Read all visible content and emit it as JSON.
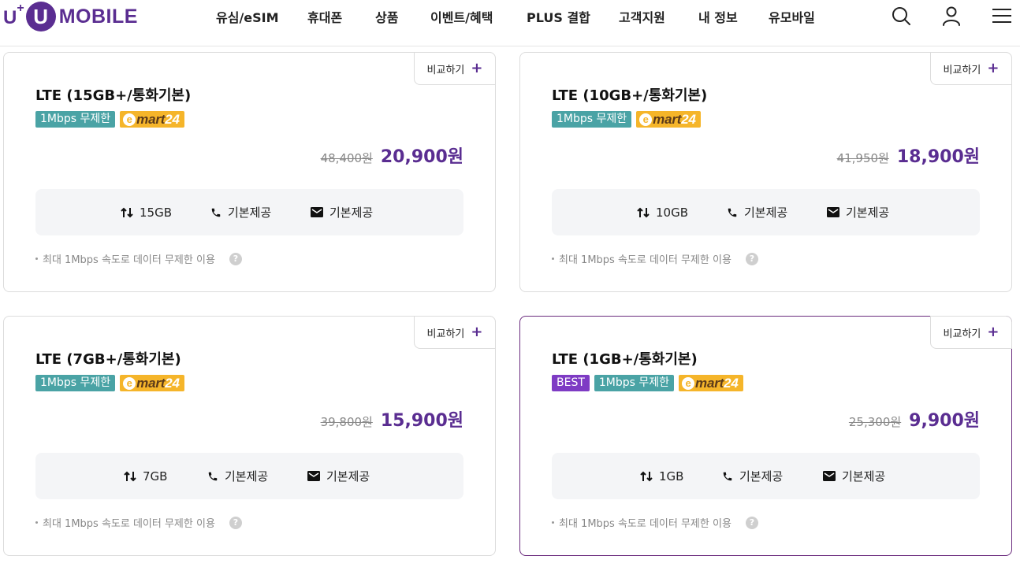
{
  "brand": {
    "uplus": "U",
    "uplus_sup": "+",
    "circle": "U",
    "word": "MOBILE",
    "color": "#5a2d91"
  },
  "nav": [
    "유심/eSIM",
    "휴대폰",
    "상품",
    "이벤트/혜택",
    "PLUS 결합",
    "고객지원",
    "내 정보",
    "유모바일"
  ],
  "header_icons": [
    "search-icon",
    "user-icon",
    "menu-icon"
  ],
  "compare_label": "비교하기",
  "compare_plus": "+",
  "cards": [
    {
      "title": "LTE (15GB+/통화기본)",
      "tags": [
        "1Mbps 무제한"
      ],
      "emart": {
        "e": "e",
        "m": "mart",
        "n": "24"
      },
      "old_price": "48,400원",
      "new_price": "20,900원",
      "data": "15GB",
      "call": "기본제공",
      "sms": "기본제공",
      "note": "최대 1Mbps 속도로 데이터 무제한 이용",
      "help": "?"
    },
    {
      "title": "LTE (10GB+/통화기본)",
      "tags": [
        "1Mbps 무제한"
      ],
      "emart": {
        "e": "e",
        "m": "mart",
        "n": "24"
      },
      "old_price": "41,950원",
      "new_price": "18,900원",
      "data": "10GB",
      "call": "기본제공",
      "sms": "기본제공",
      "note": "최대 1Mbps 속도로 데이터 무제한 이용",
      "help": "?"
    },
    {
      "title": "LTE (7GB+/통화기본)",
      "tags": [
        "1Mbps 무제한"
      ],
      "emart": {
        "e": "e",
        "m": "mart",
        "n": "24"
      },
      "old_price": "39,800원",
      "new_price": "15,900원",
      "data": "7GB",
      "call": "기본제공",
      "sms": "기본제공",
      "note": "최대 1Mbps 속도로 데이터 무제한 이용",
      "help": "?"
    },
    {
      "title": "LTE (1GB+/통화기본)",
      "best": "BEST",
      "tags": [
        "1Mbps 무제한"
      ],
      "emart": {
        "e": "e",
        "m": "mart",
        "n": "24"
      },
      "old_price": "25,300원",
      "new_price": "9,900원",
      "data": "1GB",
      "call": "기본제공",
      "sms": "기본제공",
      "note": "최대 1Mbps 속도로 데이터 무제한 이용",
      "help": "?"
    }
  ],
  "colors": {
    "accent": "#5a2d91",
    "teal_tag": "#4aa3a5",
    "best_tag": "#7e3bc4",
    "emart_tag": "#f5b52a",
    "best_border": "#6b2c7e"
  }
}
